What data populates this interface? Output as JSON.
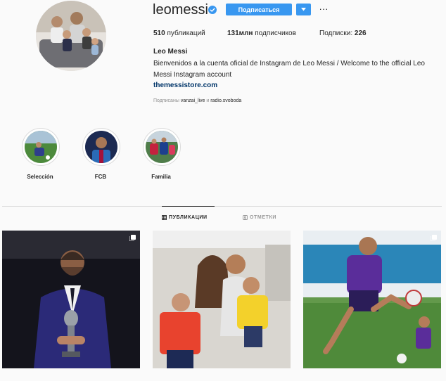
{
  "profile": {
    "username": "leomessi",
    "verified_icon": "verified-badge-icon",
    "follow_label": "Подписаться",
    "dropdown_icon": "caret-down-icon",
    "more_label": "···",
    "stats": {
      "posts_count": "510",
      "posts_label": "публикаций",
      "followers_count": "131млн",
      "followers_label": "подписчиков",
      "following_label": "Подписки:",
      "following_count": "226"
    },
    "full_name": "Leo Messi",
    "bio": "Bienvenidos a la cuenta oficial de Instagram de Leo Messi / Welcome to the official Leo Messi Instagram account",
    "website": "themessistore.com",
    "followed_by": {
      "prefix": "Подписаны",
      "user1": "vanzai_live",
      "joiner": "и",
      "user2": "radio.svoboda"
    }
  },
  "highlights": [
    {
      "label": "Selección"
    },
    {
      "label": "FCB"
    },
    {
      "label": "Familia"
    }
  ],
  "tabs": [
    {
      "label": "ПУБЛИКАЦИИ",
      "icon": "grid-icon",
      "active": true
    },
    {
      "label": "ОТМЕТКИ",
      "icon": "tagged-icon",
      "active": false
    }
  ],
  "colors": {
    "accent": "#3897f0",
    "link": "#003569",
    "background": "#fafafa"
  }
}
